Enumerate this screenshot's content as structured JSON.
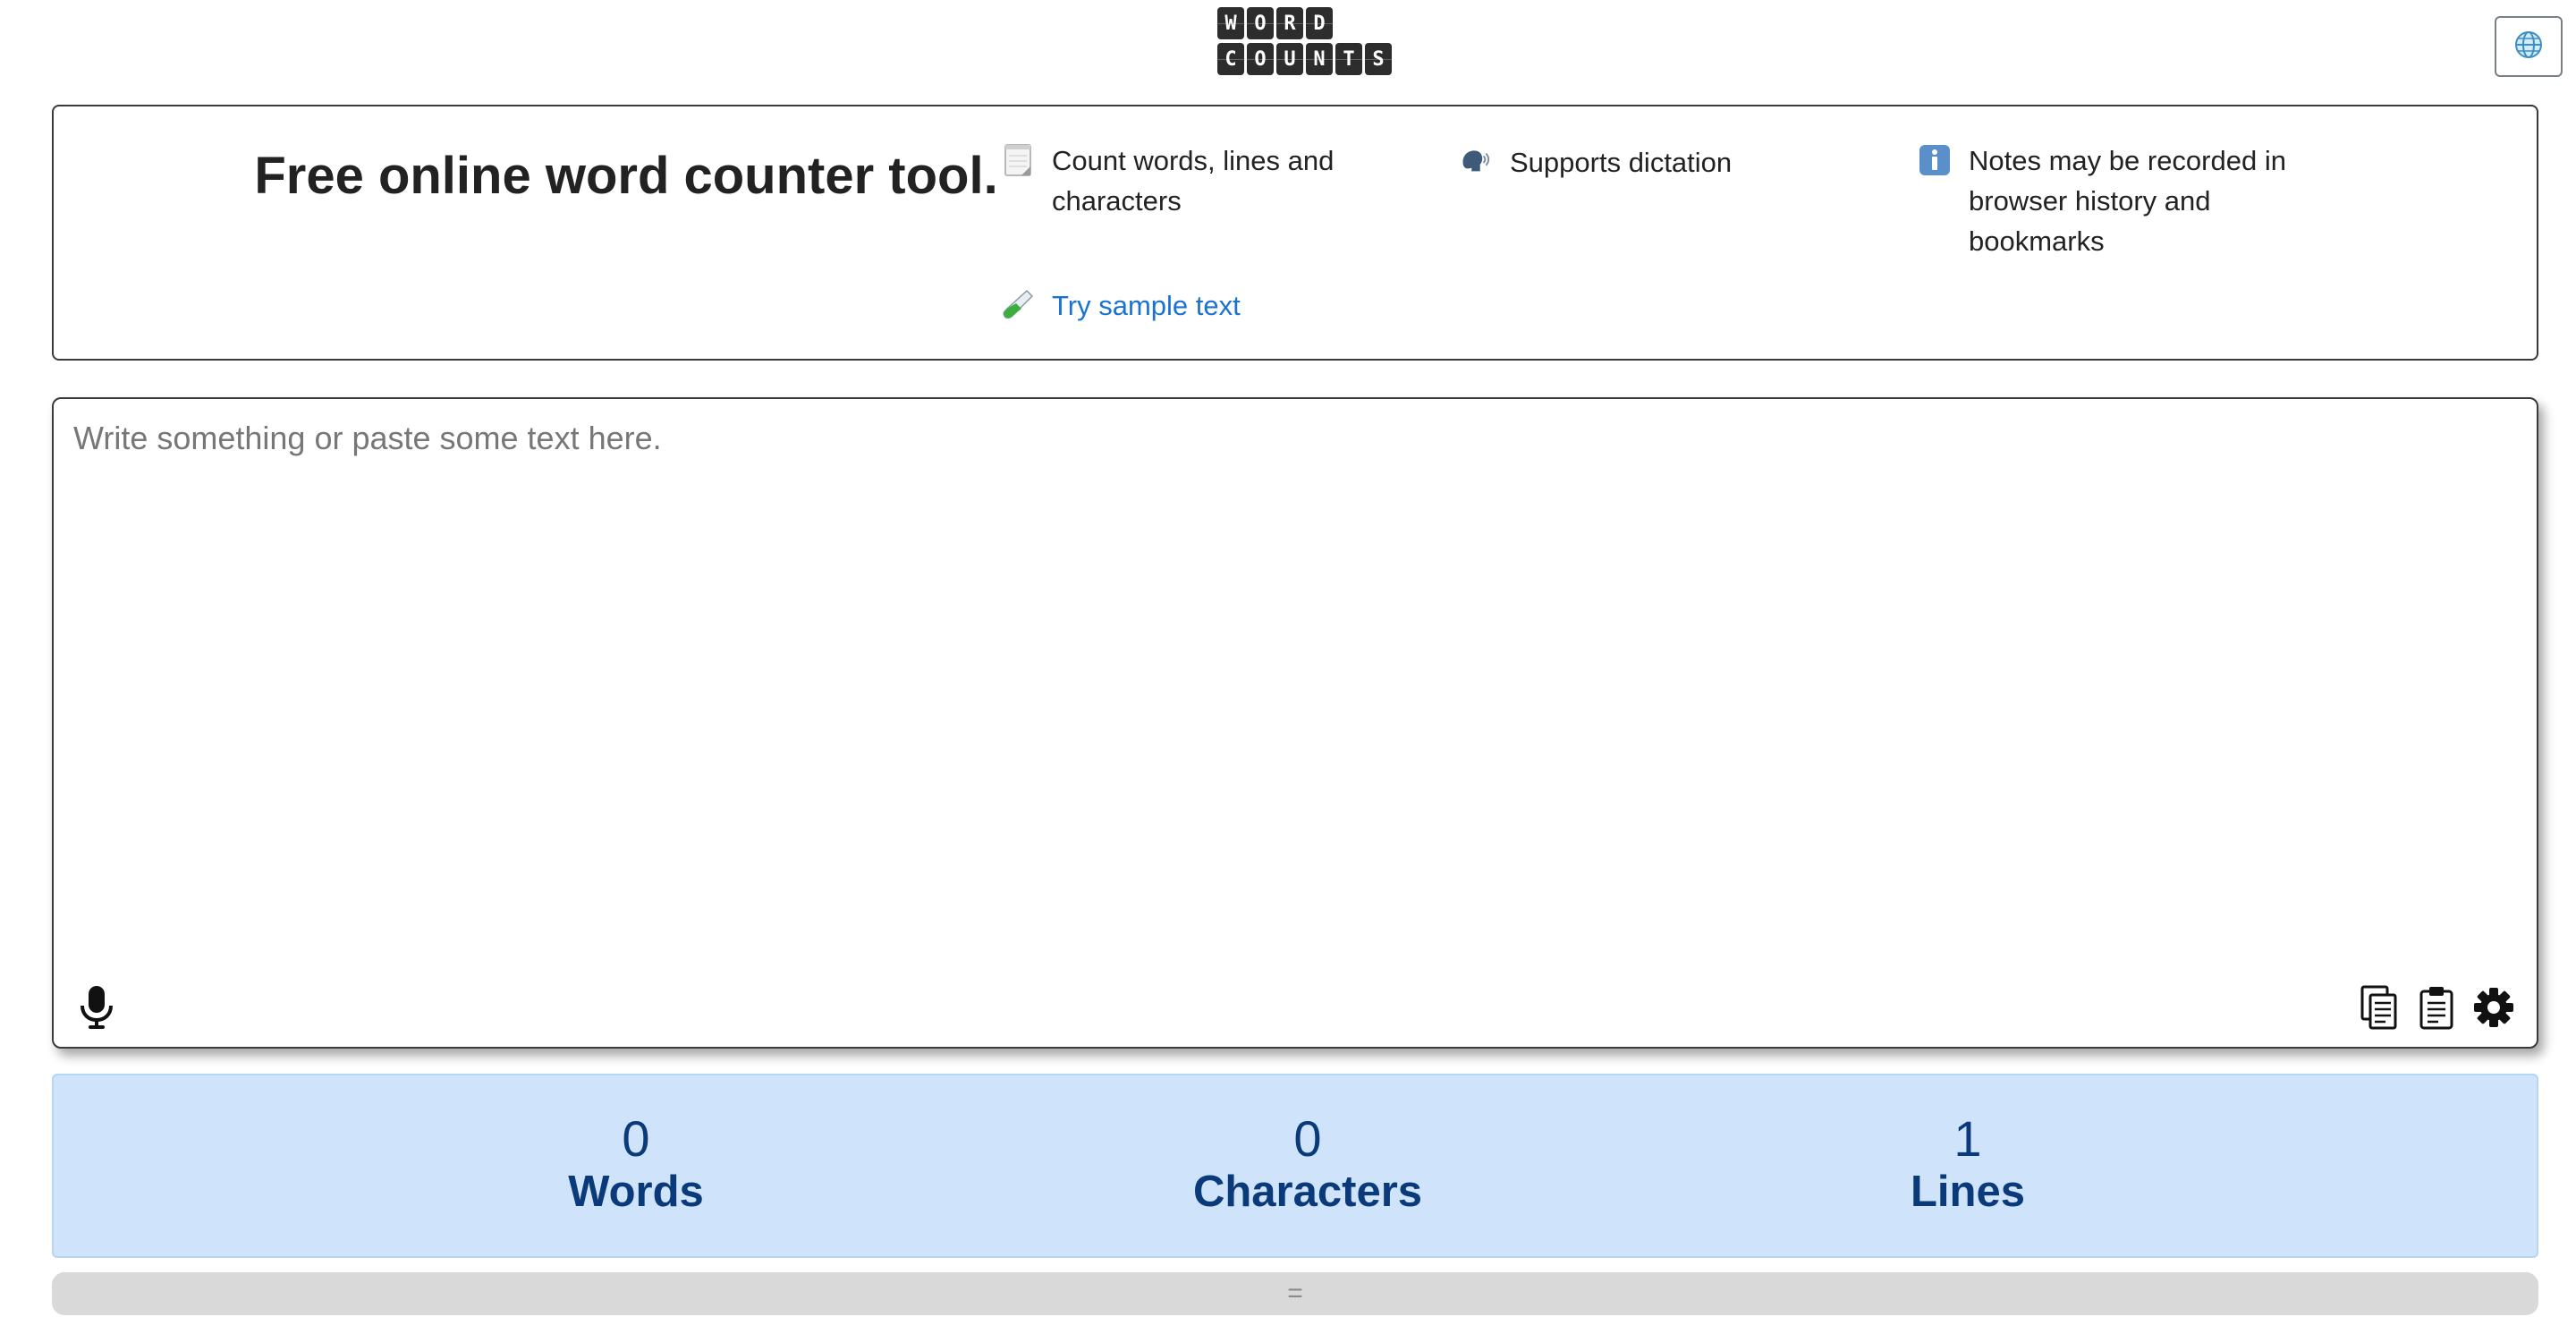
{
  "header": {
    "logo_rows": [
      [
        "W",
        "O",
        "R",
        "D"
      ],
      [
        "C",
        "O",
        "U",
        "N",
        "T",
        "S"
      ]
    ],
    "language_icon": "globe-icon"
  },
  "intro": {
    "title": "Free online word counter tool.",
    "features": {
      "count": {
        "icon": "notepad-icon",
        "text": "Count words, lines and characters"
      },
      "dictation": {
        "icon": "speaking-head-icon",
        "text": "Supports dictation"
      },
      "notes": {
        "icon": "info-icon",
        "text": "Notes may be recorded in browser history and bookmarks"
      },
      "sample": {
        "icon": "test-tube-icon",
        "text": "Try sample text"
      }
    }
  },
  "editor": {
    "placeholder": "Write something or paste some text here.",
    "value": "",
    "toolbar": {
      "mic_icon": "microphone-icon",
      "copy_icon": "copy-icon",
      "paste_icon": "clipboard-icon",
      "settings_icon": "gear-icon"
    }
  },
  "stats": {
    "words": {
      "value": "0",
      "label": "Words"
    },
    "characters": {
      "value": "0",
      "label": "Characters"
    },
    "lines": {
      "value": "1",
      "label": "Lines"
    }
  },
  "resize_handle": {
    "glyph": "="
  },
  "colors": {
    "link": "#1a73d1",
    "stats_background": "#cfe4fa",
    "stats_text": "#0a3a7a",
    "logo_tile": "#2d2d2d"
  }
}
